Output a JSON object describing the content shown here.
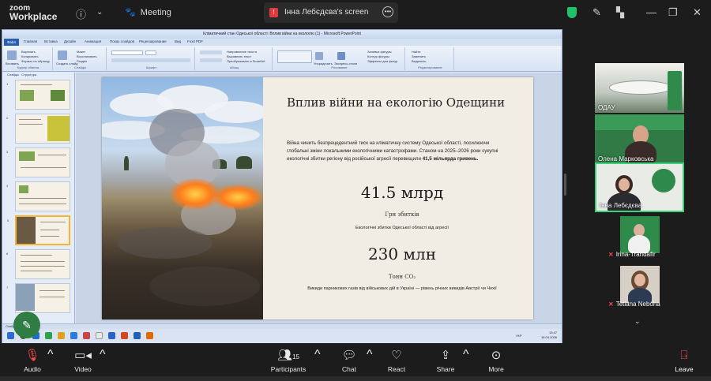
{
  "app": {
    "logo_line1": "zoom",
    "logo_line2": "Workplace",
    "meeting_label": "Meeting",
    "screen_share_label": "Інна Лебєдєва's screen"
  },
  "ppt": {
    "window_title": "Кліматичний стан Одеської області: Вплив війни на екологію (1) - Microsoft PowerPoint",
    "tabs": [
      "Файл",
      "Главная",
      "Вставка",
      "Дизайн",
      "Анимация",
      "Показ слайдов",
      "Рецензирование",
      "Вид",
      "Foxit PDF"
    ],
    "ribbon_groups": [
      "Буфер обмена",
      "Слайды",
      "Шрифт",
      "Абзац",
      "Рисование",
      "Редактирование"
    ],
    "ribbon_labels": [
      "Вырезать",
      "Копировать",
      "Формат по образцу",
      "Вставить",
      "Создать слайд",
      "Макет",
      "Восстановить",
      "Раздел",
      "Направление текста",
      "Выровнять текст",
      "Преобразовать в SmartArt",
      "Упорядочить",
      "Экспресс-стили",
      "Заливка фигуры",
      "Контур фигуры",
      "Эффекты для фигур",
      "Найти",
      "Заменить",
      "Выделить"
    ],
    "pane_tabs": [
      "Слайды",
      "Структура"
    ],
    "slide_numbers": [
      "1",
      "2",
      "3",
      "4",
      "5",
      "6",
      "7"
    ],
    "status_left": "Слайд 5 из 7",
    "taskbar_time": "13:47",
    "taskbar_date": "16.04.2026",
    "taskbar_lang": "УКР"
  },
  "slide": {
    "title": "Вплив війни на екологію Одещини",
    "body_plain": "Війна чинить безпрецедентний тиск на кліматичну систему Одеської області, посилюючи глобальні зміни локальними екологічними катастрофами. Станом на 2025–2026 роки сукупні екологічні збитки регіону від російської агресії перевищили ",
    "body_bold": "41,5 мільярда гривень.",
    "stat1_value": "41.5 млрд",
    "stat1_label": "Грн збитків",
    "stat1_desc": "Екологічні збитки Одеської області від агресії",
    "stat2_value": "230 млн",
    "stat2_label": "Тонн CO₂",
    "stat2_desc": "Викиди парникових газів від військових дій в Україні — рівень річних викидів Австрії чи Чехії"
  },
  "participants": [
    {
      "name": "ОДАУ",
      "muted": false
    },
    {
      "name": "Олена Марковська",
      "muted": false
    },
    {
      "name": "Інна Лебєдєва",
      "muted": false
    },
    {
      "name": "Irina-Trandafir",
      "muted": true
    },
    {
      "name": "Tetiana Neboha",
      "muted": true
    }
  ],
  "toolbar": {
    "audio": "Audio",
    "video": "Video",
    "participants": "Participants",
    "participants_count": "15",
    "chat": "Chat",
    "react": "React",
    "share": "Share",
    "more": "More",
    "leave": "Leave"
  },
  "icons": {
    "audio": "mic-muted-icon",
    "video": "video-camera-icon",
    "participants": "people-icon",
    "chat": "chat-bubble-icon",
    "react": "heart-icon",
    "share": "share-screen-icon",
    "more": "more-dots-icon",
    "leave": "leave-door-icon"
  },
  "colors": {
    "zoom_bg": "#1c1c1c",
    "muted_red": "#ff4a4a",
    "active_speaker": "#3ed07a",
    "slide_bg": "#f2ede4",
    "shield_green": "#21c16b"
  }
}
